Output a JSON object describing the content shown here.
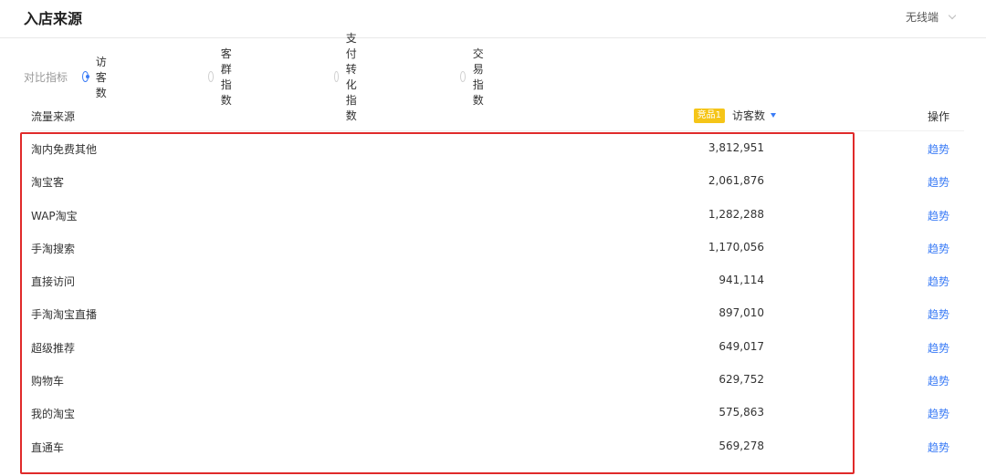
{
  "header": {
    "title": "入店来源",
    "device_select": "无线端"
  },
  "metrics": {
    "label": "对比指标",
    "options": [
      "访客数",
      "客群指数",
      "支付转化指数",
      "交易指数"
    ],
    "selected_index": 0
  },
  "table": {
    "columns": {
      "source": "流量来源",
      "badge": "竞品1",
      "visitors": "访客数",
      "operation": "操作"
    },
    "rows": [
      {
        "source": "淘内免费其他",
        "value": "3,812,951",
        "action": "趋势"
      },
      {
        "source": "淘宝客",
        "value": "2,061,876",
        "action": "趋势"
      },
      {
        "source": "WAP淘宝",
        "value": "1,282,288",
        "action": "趋势"
      },
      {
        "source": "手淘搜索",
        "value": "1,170,056",
        "action": "趋势"
      },
      {
        "source": "直接访问",
        "value": "941,114",
        "action": "趋势"
      },
      {
        "source": "手淘淘宝直播",
        "value": "897,010",
        "action": "趋势"
      },
      {
        "source": "超级推荐",
        "value": "649,017",
        "action": "趋势"
      },
      {
        "source": "购物车",
        "value": "629,752",
        "action": "趋势"
      },
      {
        "source": "我的淘宝",
        "value": "575,863",
        "action": "趋势"
      },
      {
        "source": "直通车",
        "value": "569,278",
        "action": "趋势"
      }
    ]
  },
  "colors": {
    "accent": "#3b7cf6",
    "badge": "#f5c518",
    "highlight": "#e02a2a"
  }
}
